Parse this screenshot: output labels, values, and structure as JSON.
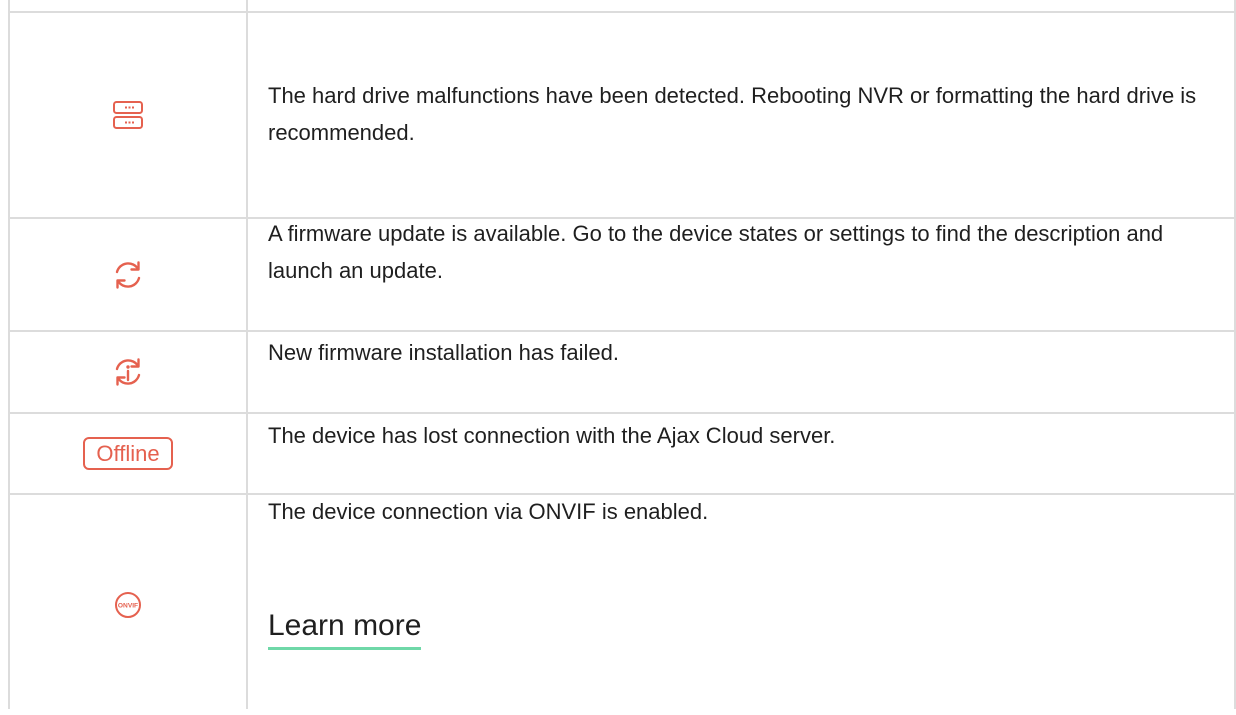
{
  "colors": {
    "accent": "#e5614f",
    "link_underline": "#6fd8a8",
    "grid_line": "#dcdcdc",
    "text": "#1f1f1f"
  },
  "rows": [
    {
      "icon": "hard-drive-icon",
      "text": "The hard drive malfunctions have been detected. Rebooting NVR or formatting the hard drive is recommended."
    },
    {
      "icon": "refresh-icon",
      "text": "A firmware update is available. Go to the device states or settings to find the description and launch an update."
    },
    {
      "icon": "update-failed-icon",
      "text": "New firmware installation has failed."
    },
    {
      "icon": "offline-badge",
      "badge_label": "Offline",
      "text": "The device has lost connection with the Ajax Cloud server."
    },
    {
      "icon": "onvif-icon",
      "icon_label": "ONVIF",
      "text": "The device connection via ONVIF is enabled.",
      "link": "Learn more"
    }
  ]
}
